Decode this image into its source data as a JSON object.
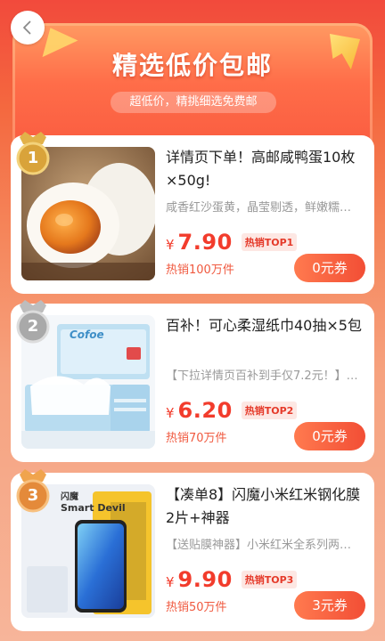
{
  "header": {
    "title": "精选低价包邮",
    "subtitle": "超低价，精挑细选免费邮"
  },
  "icons": {
    "back": "chevron-left-icon",
    "rank": "crown-medal-icon"
  },
  "colors": {
    "accent": "#f23c2c",
    "button": "#f24e35",
    "gold": "#d9a33a",
    "silver": "#a9a9a9",
    "bronze": "#e48a3a"
  },
  "products": [
    {
      "rank": "1",
      "title": "详情页下单！高邮咸鸭蛋10枚×50g!",
      "desc": "咸香红沙蛋黄，晶莹剔透，鲜嫩糯…",
      "yen": "¥",
      "price": "7.90",
      "badge": "热销TOP1",
      "sales": "热销100万件",
      "coupon": "0元券"
    },
    {
      "rank": "2",
      "title": "百补！可心柔湿纸巾40抽×5包",
      "desc": "【下拉详情页百补到手仅7.2元！】…",
      "yen": "¥",
      "price": "6.20",
      "badge": "热销TOP2",
      "sales": "热销70万件",
      "coupon": "0元券"
    },
    {
      "rank": "3",
      "title": "【凑单8】闪魔小米红米钢化膜2片+神器",
      "desc": "【送贴膜神器】小米红米全系列两…",
      "yen": "¥",
      "price": "9.90",
      "badge": "热销TOP3",
      "sales": "热销50万件",
      "coupon": "3元券"
    }
  ],
  "product_images": {
    "p1": {
      "alt": "salted-duck-egg-photo"
    },
    "p2": {
      "brand": "Cofoe",
      "alt": "wet-wipes-package-photo"
    },
    "p3": {
      "brand": "闪魔",
      "brand_en": "Smart Devil",
      "alt": "screen-protector-box-photo"
    }
  }
}
